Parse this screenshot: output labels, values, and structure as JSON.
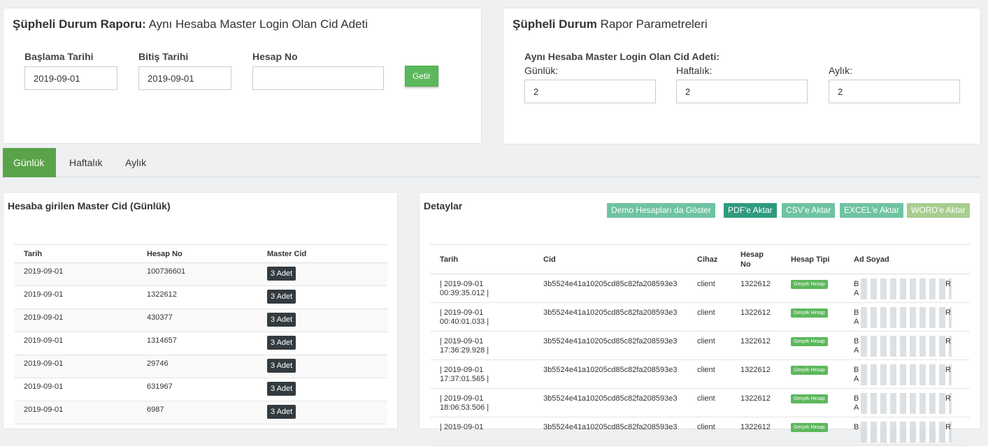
{
  "report_panel": {
    "title_bold": "Şüpheli Durum Raporu:",
    "title_rest": " Aynı Hesaba Master Login Olan Cid Adeti",
    "start_label": "Başlama Tarihi",
    "start_value": "2019-09-01",
    "end_label": "Bitiş Tarihi",
    "end_value": "2019-09-01",
    "account_label": "Hesap No",
    "account_value": "",
    "submit_label": "Getir"
  },
  "params_panel": {
    "title_bold": "Şüpheli Durum",
    "title_rest": " Rapor Parametreleri",
    "subtitle": "Aynı Hesaba Master Login Olan Cid Adeti:",
    "daily_label": "Günlük:",
    "daily_value": "2",
    "weekly_label": "Haftalık:",
    "weekly_value": "2",
    "monthly_label": "Aylık:",
    "monthly_value": "2"
  },
  "tabs": [
    "Günlük",
    "Haftalık",
    "Aylık"
  ],
  "left_table": {
    "title": "Hesaba girilen Master Cid (Günlük)",
    "headers": [
      "Tarih",
      "Hesap No",
      "Master Cid"
    ],
    "rows": [
      {
        "date": "2019-09-01",
        "account": "100736601",
        "count": "3 Adet"
      },
      {
        "date": "2019-09-01",
        "account": "1322612",
        "count": "3 Adet"
      },
      {
        "date": "2019-09-01",
        "account": "430377",
        "count": "3 Adet"
      },
      {
        "date": "2019-09-01",
        "account": "1314657",
        "count": "3 Adet"
      },
      {
        "date": "2019-09-01",
        "account": "29746",
        "count": "3 Adet"
      },
      {
        "date": "2019-09-01",
        "account": "631967",
        "count": "3 Adet"
      },
      {
        "date": "2019-09-01",
        "account": "6987",
        "count": "3 Adet"
      }
    ]
  },
  "details": {
    "title": "Detaylar",
    "buttons": {
      "demo": "Demo Hesapları da Göster",
      "pdf": "PDF'e Aktar",
      "csv": "CSV'e Aktar",
      "excel": "EXCEL'e Aktar",
      "word": "WORD'e Aktar"
    },
    "colors": {
      "demo": "#6ec3a2",
      "pdf": "#2e9a7e",
      "csv": "#6ec3a2",
      "excel": "#6ec3a2",
      "word": "#a8cd8f"
    },
    "headers": [
      "Tarih",
      "Cid",
      "Cihaz",
      "Hesap No",
      "Hesap Tipi",
      "Ad Soyad"
    ],
    "rows": [
      {
        "date1": "| 2019-09-01",
        "date2": "00:39:35.012 |",
        "cid": "3b5524e41a10205cd85c82fa208593e3",
        "device": "client",
        "account": "1322612",
        "type": "Gerçek Hesap",
        "n1": "B",
        "n2": "A",
        "n3": "R"
      },
      {
        "date1": "| 2019-09-01",
        "date2": "00:40:01.033 |",
        "cid": "3b5524e41a10205cd85c82fa208593e3",
        "device": "client",
        "account": "1322612",
        "type": "Gerçek Hesap",
        "n1": "B",
        "n2": "A",
        "n3": "R"
      },
      {
        "date1": "| 2019-09-01",
        "date2": "17:36:29.928 |",
        "cid": "3b5524e41a10205cd85c82fa208593e3",
        "device": "client",
        "account": "1322612",
        "type": "Gerçek Hesap",
        "n1": "B",
        "n2": "A",
        "n3": "R"
      },
      {
        "date1": "| 2019-09-01",
        "date2": "17:37:01.565 |",
        "cid": "3b5524e41a10205cd85c82fa208593e3",
        "device": "client",
        "account": "1322612",
        "type": "Gerçek Hesap",
        "n1": "B",
        "n2": "A",
        "n3": "R"
      },
      {
        "date1": "| 2019-09-01",
        "date2": "18:06:53.506 |",
        "cid": "3b5524e41a10205cd85c82fa208593e3",
        "device": "client",
        "account": "1322612",
        "type": "Gerçek Hesap",
        "n1": "B",
        "n2": "A",
        "n3": "R"
      },
      {
        "date1": "| 2019-09-01",
        "date2": "",
        "cid": "3b5524e41a10205cd85c82fa208593e3",
        "device": "client",
        "account": "1322612",
        "type": "Gerçek Hesap",
        "n1": "B",
        "n2": "",
        "n3": "R"
      }
    ]
  }
}
